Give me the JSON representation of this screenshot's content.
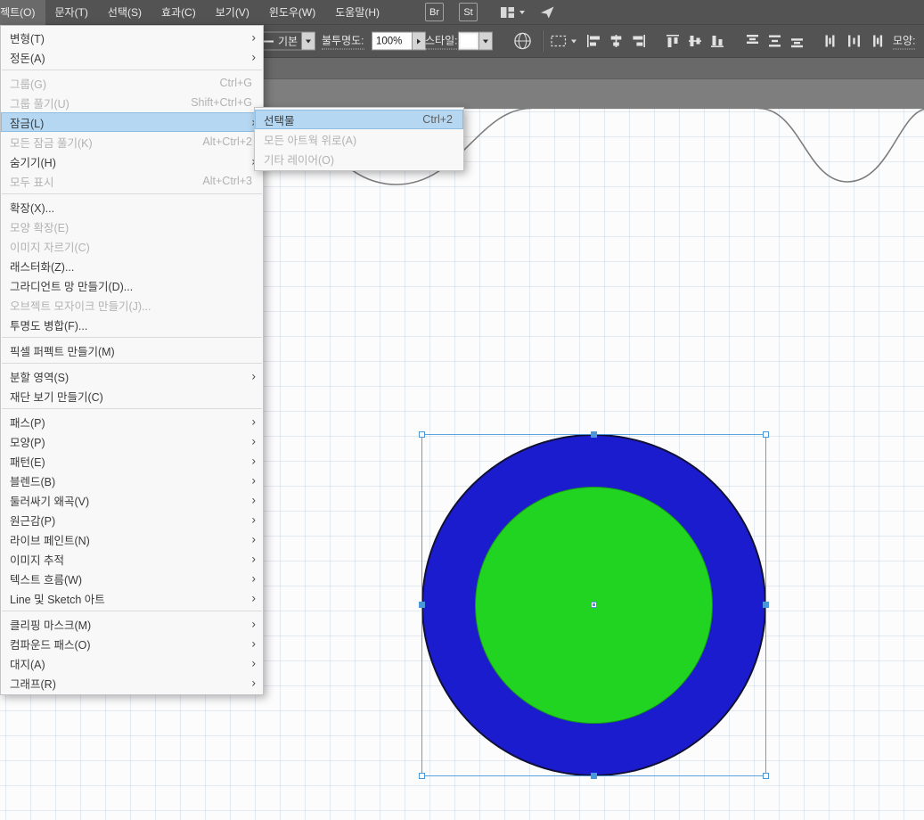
{
  "colors": {
    "bar-bg": "#535353",
    "menu-highlight": "#b5d7f2",
    "circle-outer": "#1c1ccf",
    "circle-inner": "#22d422",
    "selection": "#4a98d9",
    "curve": "#7d7d7d"
  },
  "menubar": {
    "items": [
      {
        "label": "오브젝트(O)",
        "active": true
      },
      {
        "label": "문자(T)"
      },
      {
        "label": "선택(S)"
      },
      {
        "label": "효과(C)"
      },
      {
        "label": "보기(V)"
      },
      {
        "label": "윈도우(W)"
      },
      {
        "label": "도움말(H)"
      }
    ],
    "badges": [
      {
        "label": "Br"
      },
      {
        "label": "St"
      }
    ]
  },
  "control_bar": {
    "brush_preset": "기본",
    "opacity_label": "불투명도:",
    "opacity_value": "100%",
    "style_label": "스타일:",
    "appearance_label": "모양:"
  },
  "object_menu": {
    "items": [
      {
        "label": "변형(T)",
        "submenu": true
      },
      {
        "label": "정돈(A)",
        "submenu": true
      },
      {
        "separator": true
      },
      {
        "label": "그룹(G)",
        "shortcut": "Ctrl+G",
        "disabled": true
      },
      {
        "label": "그룹 풀기(U)",
        "shortcut": "Shift+Ctrl+G",
        "disabled": true
      },
      {
        "label": "잠금(L)",
        "submenu": true,
        "highlighted": true
      },
      {
        "label": "모든 잠금 풀기(K)",
        "shortcut": "Alt+Ctrl+2",
        "disabled": true
      },
      {
        "label": "숨기기(H)",
        "submenu": true
      },
      {
        "label": "모두 표시",
        "shortcut": "Alt+Ctrl+3",
        "disabled": true
      },
      {
        "separator": true
      },
      {
        "label": "확장(X)..."
      },
      {
        "label": "모양 확장(E)",
        "disabled": true
      },
      {
        "label": "이미지 자르기(C)",
        "disabled": true
      },
      {
        "label": "래스터화(Z)..."
      },
      {
        "label": "그라디언트 망 만들기(D)..."
      },
      {
        "label": "오브젝트 모자이크 만들기(J)...",
        "disabled": true
      },
      {
        "label": "투명도 병합(F)..."
      },
      {
        "separator": true
      },
      {
        "label": "픽셀 퍼펙트 만들기(M)"
      },
      {
        "separator": true
      },
      {
        "label": "분할 영역(S)",
        "submenu": true
      },
      {
        "label": "재단 보기 만들기(C)"
      },
      {
        "separator": true
      },
      {
        "label": "패스(P)",
        "submenu": true
      },
      {
        "label": "모양(P)",
        "submenu": true
      },
      {
        "label": "패턴(E)",
        "submenu": true
      },
      {
        "label": "블렌드(B)",
        "submenu": true
      },
      {
        "label": "둘러싸기 왜곡(V)",
        "submenu": true
      },
      {
        "label": "원근감(P)",
        "submenu": true
      },
      {
        "label": "라이브 페인트(N)",
        "submenu": true
      },
      {
        "label": "이미지 추적",
        "submenu": true
      },
      {
        "label": "텍스트 흐름(W)",
        "submenu": true
      },
      {
        "label": "Line 및 Sketch 아트",
        "submenu": true
      },
      {
        "separator": true
      },
      {
        "label": "클리핑 마스크(M)",
        "submenu": true
      },
      {
        "label": "컴파운드 패스(O)",
        "submenu": true
      },
      {
        "label": "대지(A)",
        "submenu": true
      },
      {
        "label": "그래프(R)",
        "submenu": true
      }
    ]
  },
  "lock_submenu": {
    "items": [
      {
        "label": "선택물",
        "shortcut": "Ctrl+2",
        "highlighted": true
      },
      {
        "label": "모든 아트웍 위로(A)",
        "disabled": true
      },
      {
        "label": "기타 레이어(O)",
        "disabled": true
      }
    ]
  }
}
